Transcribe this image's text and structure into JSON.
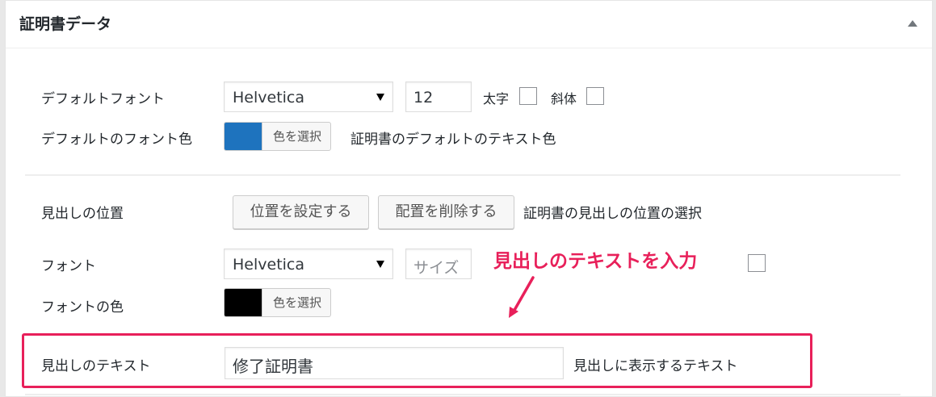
{
  "panel": {
    "title": "証明書データ"
  },
  "default_font": {
    "label": "デフォルトフォント",
    "font_value": "Helvetica",
    "size_value": "12",
    "bold_label": "太字",
    "italic_label": "斜体"
  },
  "default_font_color": {
    "label": "デフォルトのフォント色",
    "swatch_color": "#1e73be",
    "select_label": "色を選択",
    "description": "証明書のデフォルトのテキスト色"
  },
  "heading_position": {
    "label": "見出しの位置",
    "set_button": "位置を設定する",
    "remove_button": "配置を削除する",
    "description": "証明書の見出しの位置の選択"
  },
  "heading_font": {
    "label": "フォント",
    "font_value": "Helvetica",
    "size_placeholder": "サイズ"
  },
  "heading_font_color": {
    "label": "フォントの色",
    "swatch_color": "#000000",
    "select_label": "色を選択"
  },
  "heading_text": {
    "label": "見出しのテキスト",
    "value": "修了証明書",
    "description": "見出しに表示するテキスト"
  },
  "annotation": {
    "text": "見出しのテキストを入力",
    "color": "#e8205a"
  }
}
